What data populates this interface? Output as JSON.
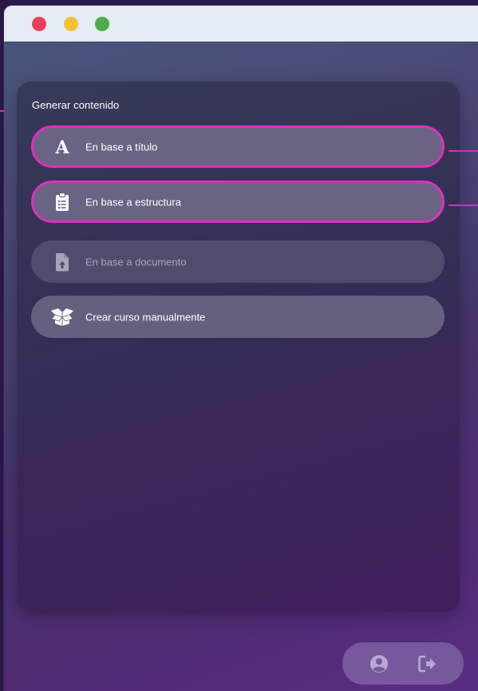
{
  "window": {
    "controls": [
      "close",
      "minimize",
      "maximize"
    ]
  },
  "panel": {
    "title": "Generar contenido",
    "options": [
      {
        "label": "En base a título",
        "icon": "letter-a-icon",
        "highlighted": true,
        "enabled": true
      },
      {
        "label": "En base a estructura",
        "icon": "clipboard-list-icon",
        "highlighted": true,
        "enabled": true
      },
      {
        "label": "En base a documento",
        "icon": "file-upload-icon",
        "highlighted": false,
        "enabled": false
      },
      {
        "label": "Crear curso manualmente",
        "icon": "open-box-icon",
        "highlighted": false,
        "enabled": true
      }
    ]
  },
  "bottom_bar": {
    "icons": [
      "user-circle-icon",
      "logout-icon"
    ]
  },
  "colors": {
    "highlight": "#e12fc0",
    "close": "#e84058",
    "minimize": "#f6c234",
    "maximize": "#47ae4a",
    "titlebar": "#e4ebf3"
  }
}
